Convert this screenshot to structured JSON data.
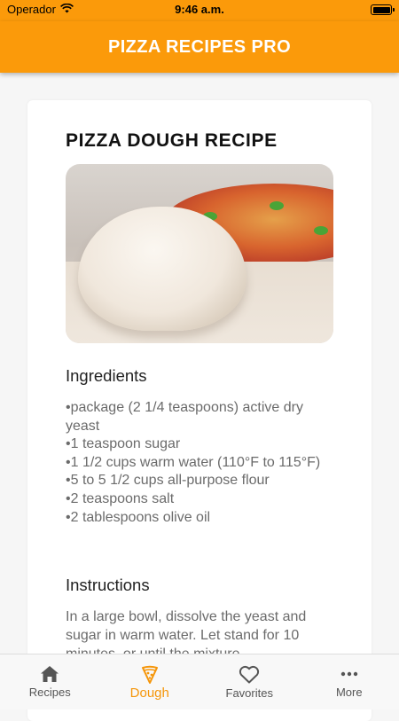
{
  "status_bar": {
    "carrier": "Operador",
    "time": "9:46 a.m."
  },
  "app_bar": {
    "title": "PIZZA RECIPES PRO"
  },
  "recipe": {
    "title": "PIZZA DOUGH RECIPE",
    "ingredients_heading": "Ingredients",
    "ingredients": [
      "package (2 1/4 teaspoons) active dry yeast",
      "1 teaspoon sugar",
      "1 1/2 cups warm water (110°F to 115°F)",
      "5 to 5 1/2 cups all-purpose flour",
      "2 teaspoons salt",
      "2 tablespoons olive oil"
    ],
    "instructions_heading": "Instructions",
    "instructions": "In a large bowl, dissolve the yeast and sugar in warm water. Let stand for 10 minutes, or until the mixture"
  },
  "tab_bar": {
    "active_color": "#f5960a",
    "tabs": [
      {
        "label": "Recipes",
        "icon": "home-icon"
      },
      {
        "label": "Dough",
        "icon": "pizza-slice-icon",
        "active": true
      },
      {
        "label": "Favorites",
        "icon": "heart-icon"
      },
      {
        "label": "More",
        "icon": "more-dots-icon"
      }
    ]
  },
  "colors": {
    "brand": "#fb9a0a",
    "background": "#f6f6f6"
  }
}
